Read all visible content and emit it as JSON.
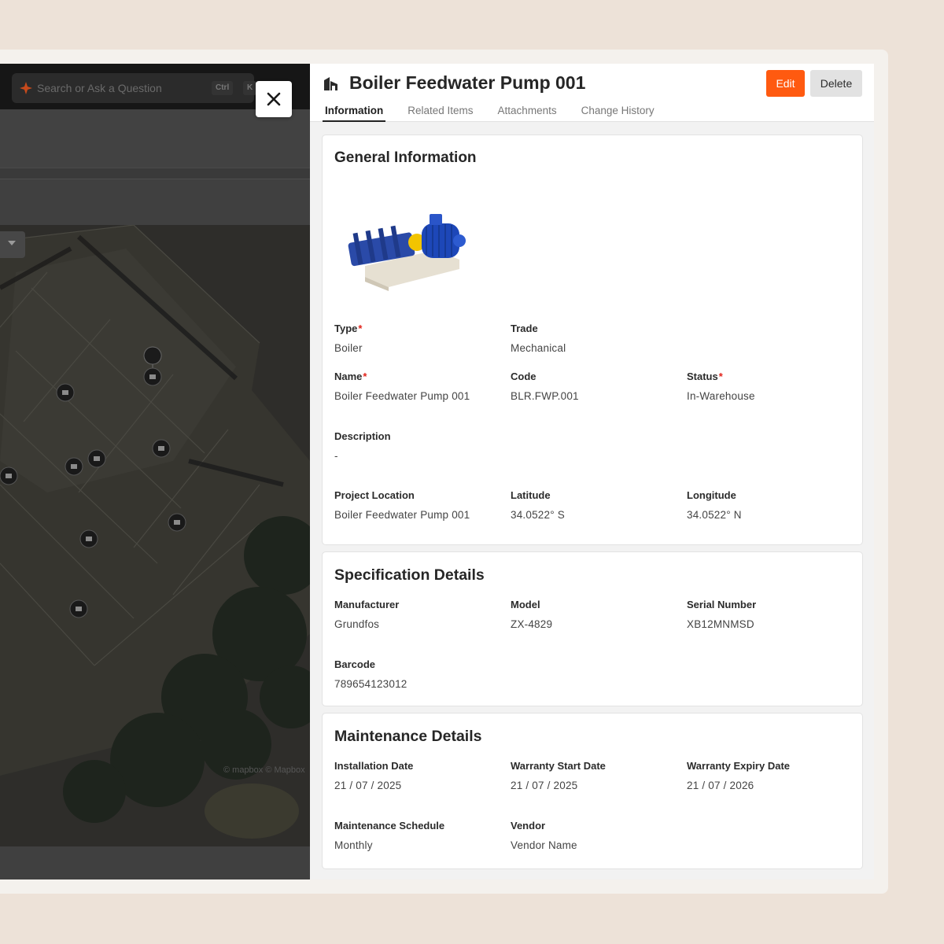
{
  "map": {
    "search_placeholder": "Search or Ask a Question",
    "shortcut_ctrl": "Ctrl",
    "shortcut_key": "K",
    "attribution": "© mapbox  © Mapbox"
  },
  "detail": {
    "title": "Boiler Feedwater Pump 001",
    "edit_label": "Edit",
    "delete_label": "Delete",
    "tabs": [
      "Information",
      "Related Items",
      "Attachments",
      "Change History"
    ],
    "active_tab": "Information"
  },
  "general": {
    "title": "General Information",
    "type_label": "Type",
    "type_value": "Boiler",
    "trade_label": "Trade",
    "trade_value": "Mechanical",
    "name_label": "Name",
    "name_value": "Boiler Feedwater Pump 001",
    "code_label": "Code",
    "code_value": "BLR.FWP.001",
    "status_label": "Status",
    "status_value": "In-Warehouse",
    "description_label": "Description",
    "description_value": "-",
    "location_label": "Project Location",
    "location_value": "Boiler Feedwater Pump 001",
    "latitude_label": "Latitude",
    "latitude_value": "34.0522° S",
    "longitude_label": "Longitude",
    "longitude_value": "34.0522° N"
  },
  "spec": {
    "title": "Specification Details",
    "manufacturer_label": "Manufacturer",
    "manufacturer_value": "Grundfos",
    "model_label": "Model",
    "model_value": "ZX-4829",
    "serial_label": "Serial Number",
    "serial_value": "XB12MNMSD",
    "barcode_label": "Barcode",
    "barcode_value": "789654123012"
  },
  "maintenance": {
    "title": "Maintenance Details",
    "install_label": "Installation Date",
    "install_value": "21 / 07 / 2025",
    "wstart_label": "Warranty Start Date",
    "wstart_value": "21 / 07 / 2025",
    "wexpiry_label": "Warranty Expiry Date",
    "wexpiry_value": "21 / 07 / 2026",
    "schedule_label": "Maintenance Schedule",
    "schedule_value": "Monthly",
    "vendor_label": "Vendor",
    "vendor_value": "Vendor Name"
  },
  "colors": {
    "accent": "#ff5a10",
    "required": "#e2231a",
    "page_bg": "#ede2d8"
  }
}
